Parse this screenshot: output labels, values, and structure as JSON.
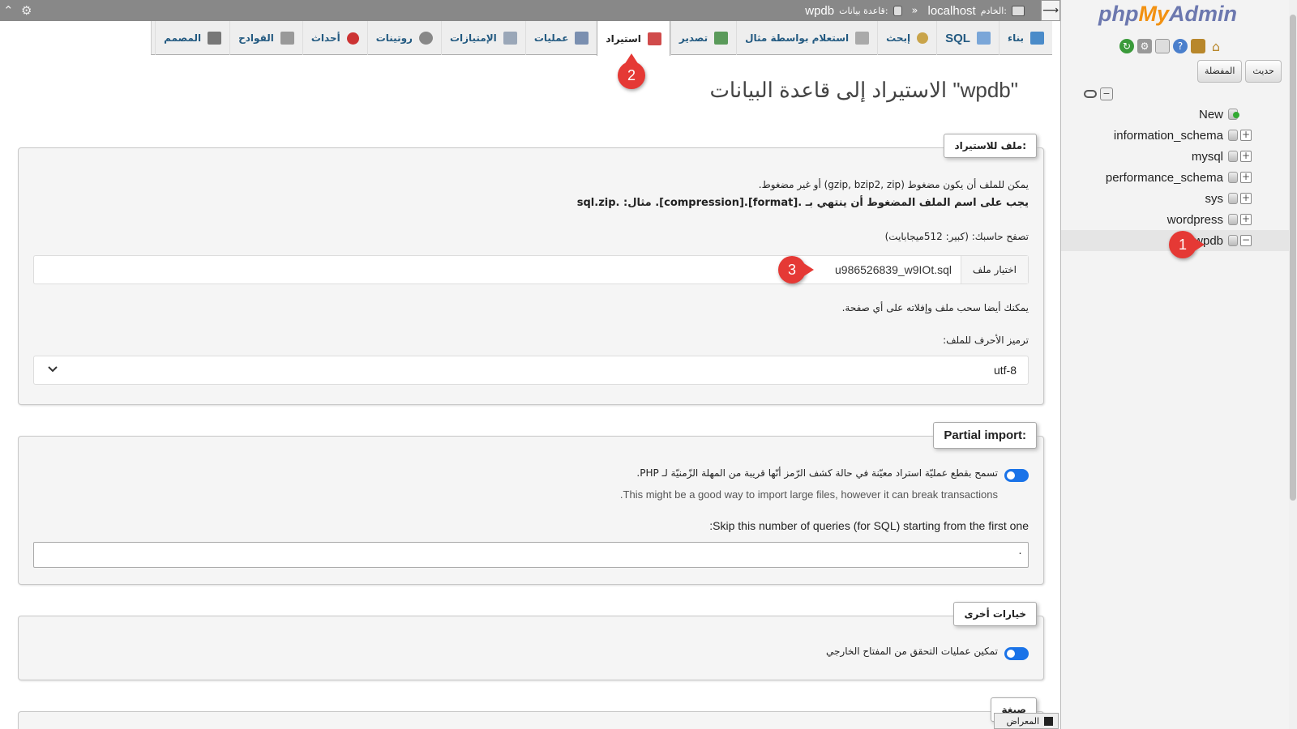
{
  "topbar": {
    "server_label": "الخادم:",
    "server_value": "localhost",
    "separator": "»",
    "db_label": "قاعدة بيانات:",
    "db_value": "wpdb",
    "fold_symbol": "⟶"
  },
  "tabs": [
    {
      "label": "بناء",
      "icon": "structure-icon",
      "color": "#4a8bc9"
    },
    {
      "label": "SQL",
      "icon": "sql-icon",
      "color": "#7aa6d8"
    },
    {
      "label": "إبحث",
      "icon": "search-icon",
      "color": "#c9a44a"
    },
    {
      "label": "استعلام بواسطة مثال",
      "icon": "query-icon",
      "color": "#aaaaaa"
    },
    {
      "label": "تصدير",
      "icon": "export-icon",
      "color": "#5a9a5a"
    },
    {
      "label": "استيراد",
      "icon": "import-icon",
      "color": "#d04b4b",
      "active": true
    },
    {
      "label": "عمليات",
      "icon": "operations-icon",
      "color": "#7a8fb0"
    },
    {
      "label": "الإمتيازات",
      "icon": "privileges-icon",
      "color": "#9aa7b8"
    },
    {
      "label": "روتينات",
      "icon": "routines-icon",
      "color": "#888888"
    },
    {
      "label": "أحداث",
      "icon": "events-icon",
      "color": "#cc3333"
    },
    {
      "label": "القوادح",
      "icon": "triggers-icon",
      "color": "#999999"
    },
    {
      "label": "المصمم",
      "icon": "designer-icon",
      "color": "#777777"
    }
  ],
  "page_title": "الاستيراد إلى قاعدة البيانات \"wpdb\"",
  "file_section": {
    "legend": "ملف للاستيراد:",
    "line1": "يمكن للملف أن يكون مضغوط (gzip, bzip2, zip) أو غير مضغوط.",
    "line2": "يجب على اسم الملف المضغوط أن ينتهي بـ .[format].[compression]. مثال: .sql.zip",
    "browse_label": "تصفح حاسبك: (كبير: 512ميجابايت)",
    "choose_button": "اختيار ملف",
    "file_name": "u986526839_w9IOt.sql",
    "drag_hint": "يمكنك أيضا سحب ملف وإفلاته على أي صفحة.",
    "charset_label": "ترميز الأحرف للملف:",
    "charset_value": "utf-8"
  },
  "partial_section": {
    "legend": "Partial import:",
    "allow_interrupt": "تسمح بقطع عمليّة استراد معيّنة في حالة كشف الرّمز أنّها قريبة من المهلة الزّمنيّة لـ PHP.",
    "hint": "This might be a good way to import large files, however it can break transactions.",
    "skip_label": "Skip this number of queries (for SQL) starting from the first one:",
    "skip_value": "٠"
  },
  "other_section": {
    "legend": "خيارات أخرى",
    "fk_checks": "تمكين عمليات التحقق من المفتاح الخارجي"
  },
  "format_section": {
    "legend": "صيغة"
  },
  "sidebar": {
    "logo_php": "php",
    "logo_my": "My",
    "logo_admin": "Admin",
    "recent": "حديث",
    "favorites": "المفضلة",
    "databases": [
      {
        "name": "New",
        "type": "new"
      },
      {
        "name": "information_schema",
        "type": "db"
      },
      {
        "name": "mysql",
        "type": "db"
      },
      {
        "name": "performance_schema",
        "type": "db"
      },
      {
        "name": "sys",
        "type": "db"
      },
      {
        "name": "wordpress",
        "type": "db"
      },
      {
        "name": "wpdb",
        "type": "db",
        "active": true
      }
    ]
  },
  "console": {
    "label": "المعراض"
  },
  "markers": [
    "1",
    "2",
    "3"
  ],
  "colors": {
    "accent": "#235a81",
    "marker": "#e53935",
    "toggle": "#1a73e8",
    "topbar": "#888888"
  }
}
